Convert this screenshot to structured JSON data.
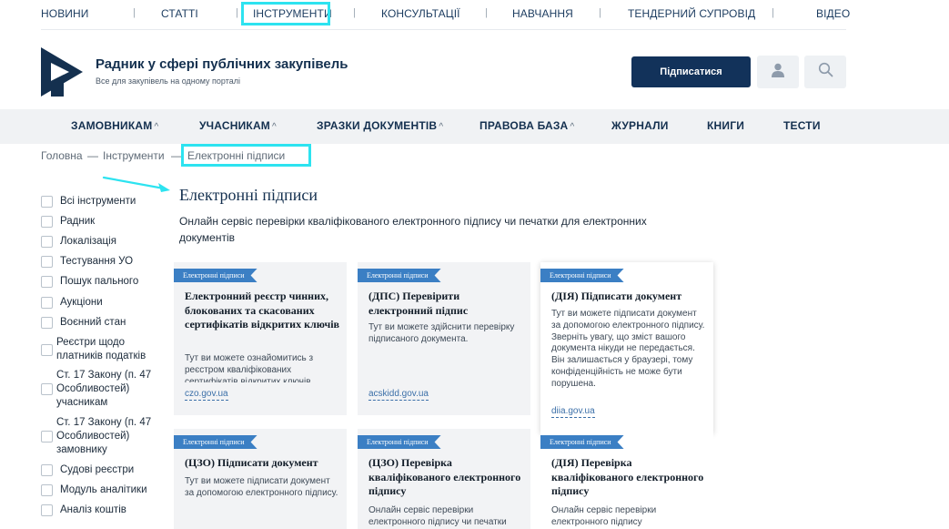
{
  "topnav": {
    "items": [
      "НОВИНИ",
      "СТАТТІ",
      "ІНСТРУМЕНТИ",
      "КОНСУЛЬТАЦІЇ",
      "НАВЧАННЯ",
      "ТЕНДЕРНИЙ СУПРОВІД",
      "ВІДЕО"
    ],
    "separator": "|"
  },
  "header": {
    "title": "Радник у сфері публічних закупівель",
    "subtitle": "Все для закупівель на одному порталі",
    "subscribe_label": "Підписатися"
  },
  "mainnav": {
    "items": [
      "ЗАМОВНИКАМ",
      "УЧАСНИКАМ",
      "ЗРАЗКИ ДОКУМЕНТІВ",
      "ПРАВОВА БАЗА",
      "ЖУРНАЛИ",
      "КНИГИ",
      "ТЕСТИ"
    ],
    "caret": "^"
  },
  "breadcrumb": {
    "home": "Головна",
    "section": "Інструменти",
    "current": "Електронні підписи",
    "sep": "—"
  },
  "sidebar": {
    "filters": [
      "Всі інструменти",
      "Радник",
      "Локалізація",
      "Тестування УО",
      "Пошук пального",
      "Аукціони",
      "Воєнний стан",
      "Реєстри щодо платників податків",
      "Ст. 17 Закону (п. 47 Особливостей) учасникам",
      "Ст. 17 Закону (п. 47 Особливостей) замовнику",
      "Судові реєстри",
      "Модуль аналітики",
      "Аналіз коштів"
    ]
  },
  "main": {
    "title": "Електронні підписи",
    "description": "Онлайн сервіс перевірки кваліфікованого електронного підпису чи печатки для електронних документів",
    "cards": [
      {
        "tag": "Електронні підписи",
        "title": "Електронний реєстр чинних, блокованих та скасованих сертифікатів відкритих ключів",
        "text": "Тут ви можете ознайомитись з реєстром кваліфікованих сертифікатів відкритих ключів",
        "link": "czo.gov.ua"
      },
      {
        "tag": "Електронні підписи",
        "title": "(ДПС) Перевірити електронний підпис",
        "text": "Тут ви можете здійснити перевірку підписаного документа.",
        "link": "acskidd.gov.ua"
      },
      {
        "tag": "Електронні підписи",
        "title": "(ДІЯ) Підписати документ",
        "text": "Тут ви можете підписати документ за допомогою електронного підпису.  Зверніть увагу, що зміст вашого документа нікуди не передається. Він залишається у браузері, тому конфіденційність не може бути порушена.",
        "link": "diia.gov.ua"
      },
      {
        "tag": "Електронні підписи",
        "title": "(ЦЗО) Підписати документ",
        "text": "Тут ви можете підписати документ за допомогою електронного підпису.",
        "link": ""
      },
      {
        "tag": "Електронні підписи",
        "title": "(ЦЗО) Перевірка кваліфікованого електронного підпису",
        "text": "Онлайн сервіс перевірки електронного підпису чи печатки",
        "link": ""
      },
      {
        "tag": "Електронні підписи",
        "title": "(ДІЯ) Перевірка кваліфікованого електронного підпису",
        "text": "Онлайн сервіс перевірки електронного підпису",
        "link": ""
      }
    ]
  },
  "colors": {
    "accent": "#12325a",
    "tag": "#3b7fc4",
    "highlight": "#2de3f0",
    "link": "#3b6fa8"
  },
  "icons": [
    "user-icon",
    "search-icon",
    "arrow-annotation-icon",
    "logo-icon"
  ]
}
